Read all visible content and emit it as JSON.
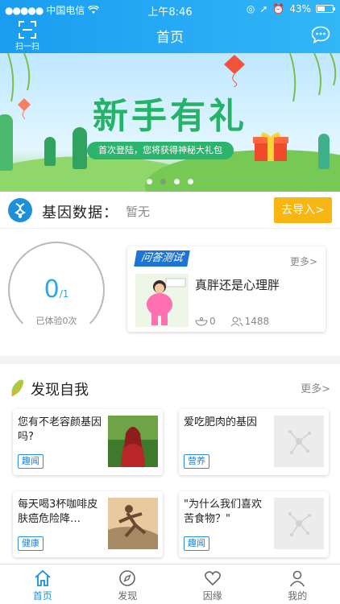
{
  "status_bar": {
    "carrier": "中国电信",
    "time": "上午8:46",
    "battery": "43%"
  },
  "nav": {
    "title": "首页",
    "scan_label": "扫一扫"
  },
  "banner": {
    "title": "新手有礼",
    "subtitle": "首次登陆，您将获得神秘大礼包"
  },
  "gene": {
    "label": "基因数据：",
    "value": "暂无",
    "import_label": "去导入>"
  },
  "stats": {
    "count": "0",
    "total": "/1",
    "caption": "已体验0次"
  },
  "quiz": {
    "tag": "问答测试",
    "more": "更多>",
    "title": "真胖还是心理胖",
    "likes": "0",
    "participants": "1488"
  },
  "discover": {
    "title": "发现自我",
    "more": "更多>",
    "cards": [
      {
        "title": "您有不老容颜基因吗?",
        "tag": "趣闻"
      },
      {
        "title": "爱吃肥肉的基因",
        "tag": "营养"
      },
      {
        "title": "每天喝3杯咖啡皮肤癌危险降…",
        "tag": "健康"
      },
      {
        "title": "\"为什么我们喜欢苦食物？\"",
        "tag": "趣闻"
      }
    ]
  },
  "tabs": [
    {
      "label": "首页",
      "icon": "home-icon"
    },
    {
      "label": "发现",
      "icon": "compass-icon"
    },
    {
      "label": "因缘",
      "icon": "heart-icon"
    },
    {
      "label": "我的",
      "icon": "user-icon"
    }
  ],
  "colors": {
    "primary": "#1a9df0",
    "accent": "#f7b613",
    "banner_green": "#24b36a"
  }
}
